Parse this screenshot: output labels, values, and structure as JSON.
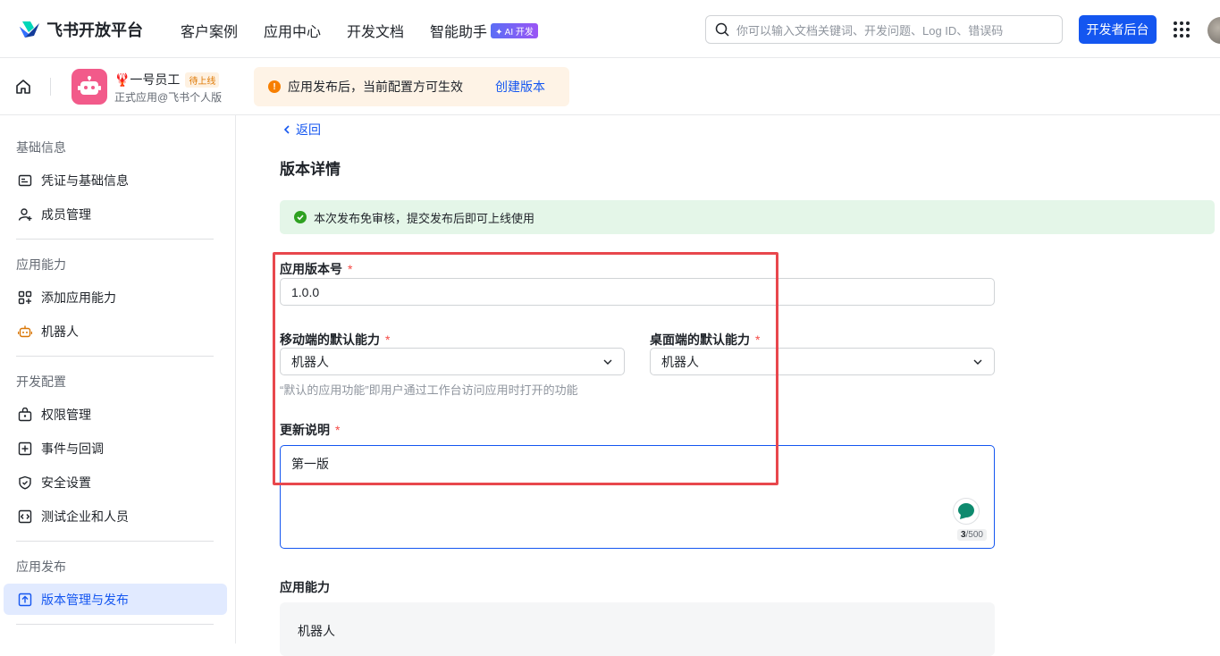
{
  "topbar": {
    "logo_text": "飞书开放平台",
    "nav": [
      "客户案例",
      "应用中心",
      "开发文档",
      "智能助手"
    ],
    "ai_badge": "✦ AI 开发",
    "search_placeholder": "你可以输入文档关键词、开发问题、Log ID、错误码",
    "dev_console_label": "开发者后台"
  },
  "app": {
    "name": "🦞一号员工",
    "status_tag": "待上线",
    "subtitle": "正式应用@飞书个人版",
    "notice_text": "应用发布后，当前配置方可生效",
    "notice_link": "创建版本"
  },
  "sidebar": {
    "sections": [
      {
        "title": "基础信息",
        "items": [
          {
            "label": "凭证与基础信息",
            "icon": "id-card-icon"
          },
          {
            "label": "成员管理",
            "icon": "add-member-icon"
          }
        ]
      },
      {
        "title": "应用能力",
        "items": [
          {
            "label": "添加应用能力",
            "icon": "apps-add-icon"
          },
          {
            "label": "机器人",
            "icon": "robot-icon"
          }
        ]
      },
      {
        "title": "开发配置",
        "items": [
          {
            "label": "权限管理",
            "icon": "lock-bag-icon"
          },
          {
            "label": "事件与回调",
            "icon": "plus-square-icon"
          },
          {
            "label": "安全设置",
            "icon": "shield-icon"
          },
          {
            "label": "测试企业和人员",
            "icon": "code-square-icon"
          }
        ]
      },
      {
        "title": "应用发布",
        "items": [
          {
            "label": "版本管理与发布",
            "icon": "upload-square-icon",
            "active": true
          }
        ]
      }
    ]
  },
  "main": {
    "back_label": "返回",
    "title": "版本详情",
    "success_text": "本次发布免审核，提交发布后即可上线使用",
    "version_label": "应用版本号",
    "version_value": "1.0.0",
    "mobile_label": "移动端的默认能力",
    "mobile_value": "机器人",
    "desktop_label": "桌面端的默认能力",
    "desktop_value": "机器人",
    "default_hint": "“默认的应用功能”即用户通过工作台访问应用时打开的功能",
    "notes_label": "更新说明",
    "notes_value": "第一版",
    "notes_count": "3",
    "notes_max": "/500",
    "capability_label": "应用能力",
    "capability_item": "机器人"
  },
  "colors": {
    "accent": "#1456f0",
    "success": "#2ea121",
    "warning": "#f77f00",
    "highlight_box": "#e8474d"
  }
}
